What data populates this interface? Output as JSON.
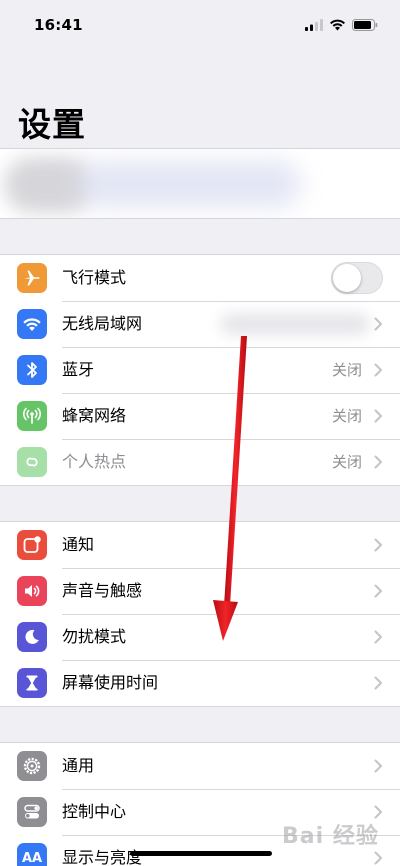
{
  "status_bar": {
    "time": "16:41"
  },
  "title": "设置",
  "groups": [
    {
      "rows": [
        {
          "label": "飞行模式",
          "icon": "airplane-icon",
          "color": "#f09a37",
          "control": "toggle",
          "toggle_on": false
        },
        {
          "label": "无线局域网",
          "icon": "wifi-icon",
          "color": "#3478f6",
          "value": ""
        },
        {
          "label": "蓝牙",
          "icon": "bluetooth-icon",
          "color": "#3478f6",
          "value": "关闭"
        },
        {
          "label": "蜂窝网络",
          "icon": "cellular-icon",
          "color": "#65c466",
          "value": "关闭"
        },
        {
          "label": "个人热点",
          "icon": "hotspot-icon",
          "color": "#a6dfa8",
          "value": "关闭",
          "dimmed": true
        }
      ]
    },
    {
      "rows": [
        {
          "label": "通知",
          "icon": "notifications-icon",
          "color": "#eb4d3d"
        },
        {
          "label": "声音与触感",
          "icon": "speaker-icon",
          "color": "#e9445a"
        },
        {
          "label": "勿扰模式",
          "icon": "moon-icon",
          "color": "#5856d6"
        },
        {
          "label": "屏幕使用时间",
          "icon": "hourglass-icon",
          "color": "#5856d6"
        }
      ]
    },
    {
      "rows": [
        {
          "label": "通用",
          "icon": "gear-icon",
          "color": "#8e8e93"
        },
        {
          "label": "控制中心",
          "icon": "toggles-icon",
          "color": "#8e8e93"
        },
        {
          "label": "显示与亮度",
          "icon": "text-size-icon",
          "color": "#3478f6",
          "glyph": "AA"
        }
      ]
    }
  ],
  "overlay": {
    "arrow_color": "#e8151b"
  },
  "watermark": "Bai 经验"
}
